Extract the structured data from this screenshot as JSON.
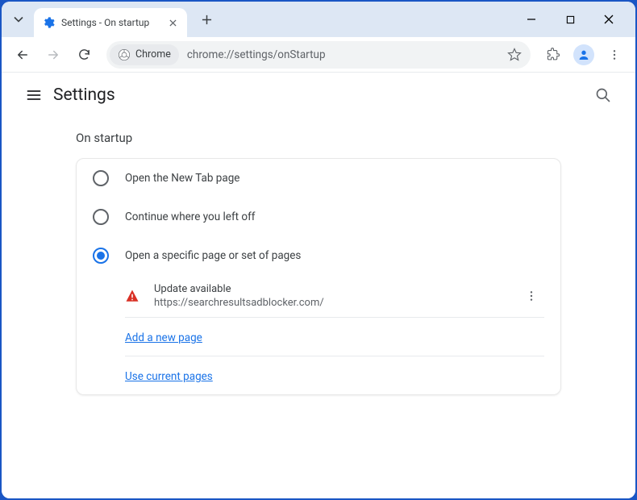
{
  "tab": {
    "title": "Settings - On startup"
  },
  "addressbar": {
    "chip": "Chrome",
    "url": "chrome://settings/onStartup"
  },
  "settings": {
    "title": "Settings"
  },
  "section": {
    "heading": "On startup"
  },
  "options": {
    "new_tab": "Open the New Tab page",
    "continue": "Continue where you left off",
    "specific": "Open a specific page or set of pages"
  },
  "page_entry": {
    "title": "Update available",
    "url": "https://searchresultsadblocker.com/"
  },
  "links": {
    "add_page": "Add a new page",
    "use_current": "Use current pages"
  }
}
